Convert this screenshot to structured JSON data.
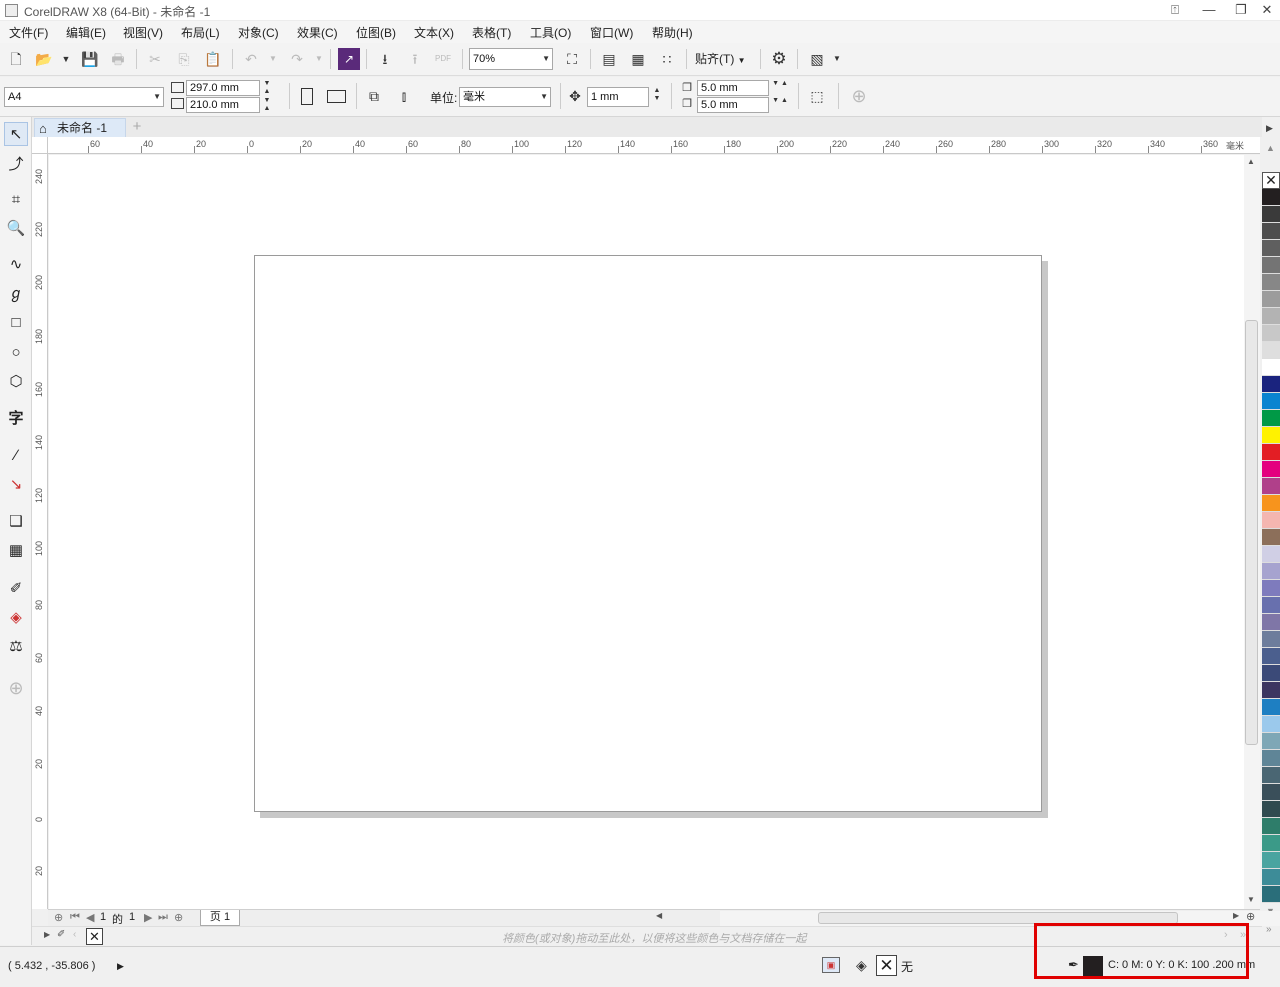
{
  "window": {
    "title": "CorelDRAW X8 (64-Bit) - 未命名 -1",
    "controls": [
      "⍐",
      "—",
      "❐",
      "✕"
    ]
  },
  "menu": [
    "文件(F)",
    "编辑(E)",
    "视图(V)",
    "布局(L)",
    "对象(C)",
    "效果(C)",
    "位图(B)",
    "文本(X)",
    "表格(T)",
    "工具(O)",
    "窗口(W)",
    "帮助(H)"
  ],
  "toolbar": {
    "zoom_value": "70%",
    "snap_label": "贴齐(T)",
    "pdf_label": "PDF"
  },
  "property_bar": {
    "page_size": "A4",
    "width": "297.0 mm",
    "height": "210.0 mm",
    "unit_label": "单位:",
    "unit_value": "毫米",
    "nudge": "1 mm",
    "dup_x": "5.0 mm",
    "dup_y": "5.0 mm"
  },
  "document": {
    "tab_label": "未命名 -1",
    "add_tab": "+"
  },
  "ruler": {
    "unit": "毫米",
    "top_ticks": [
      "60",
      "40",
      "20",
      "0",
      "20",
      "40",
      "60",
      "80",
      "100",
      "120",
      "140",
      "160",
      "180",
      "200",
      "220",
      "240",
      "260",
      "280",
      "300",
      "320",
      "340",
      "360"
    ],
    "left_ticks": [
      "240",
      "220",
      "200",
      "180",
      "160",
      "140",
      "120",
      "100",
      "80",
      "60",
      "40",
      "20",
      "0",
      "20"
    ]
  },
  "page_nav": {
    "current": "1",
    "of_label": "的",
    "total": "1",
    "page_tab": "页 1"
  },
  "doc_palette": {
    "hint": "将颜色(或对象)拖动至此处，以便将这些颜色与文档存储在一起"
  },
  "status": {
    "coords": "( 5.432 , -35.806 )",
    "fill_label": "无",
    "outline_info": "C: 0 M: 0 Y: 0 K: 100  .200 mm"
  },
  "palette_colors": [
    "#231f20",
    "#3a3a3a",
    "#4d4d4d",
    "#5f5f5f",
    "#747474",
    "#878787",
    "#9c9c9c",
    "#b3b3b3",
    "#c8c8c8",
    "#dedede",
    "#ffffff",
    "#1a237e",
    "#0a84d0",
    "#009946",
    "#fff200",
    "#e31e24",
    "#e4007f",
    "#b0408a",
    "#f7941d",
    "#f4b6b0",
    "#8c6f5a",
    "#d0cfe5",
    "#a6a3cf",
    "#7e7bbd",
    "#6870ae",
    "#7f76a7",
    "#6d7d9c",
    "#4b5f8e",
    "#3b4a78",
    "#3c3560",
    "#1e7fc2",
    "#9bc9ec",
    "#7ea7b6",
    "#5f8597",
    "#4a6673",
    "#3a4f5a",
    "#2f4a4f",
    "#2e7d6a",
    "#3b9a88",
    "#4aa4a0",
    "#3d8c98",
    "#2a6e7a"
  ]
}
